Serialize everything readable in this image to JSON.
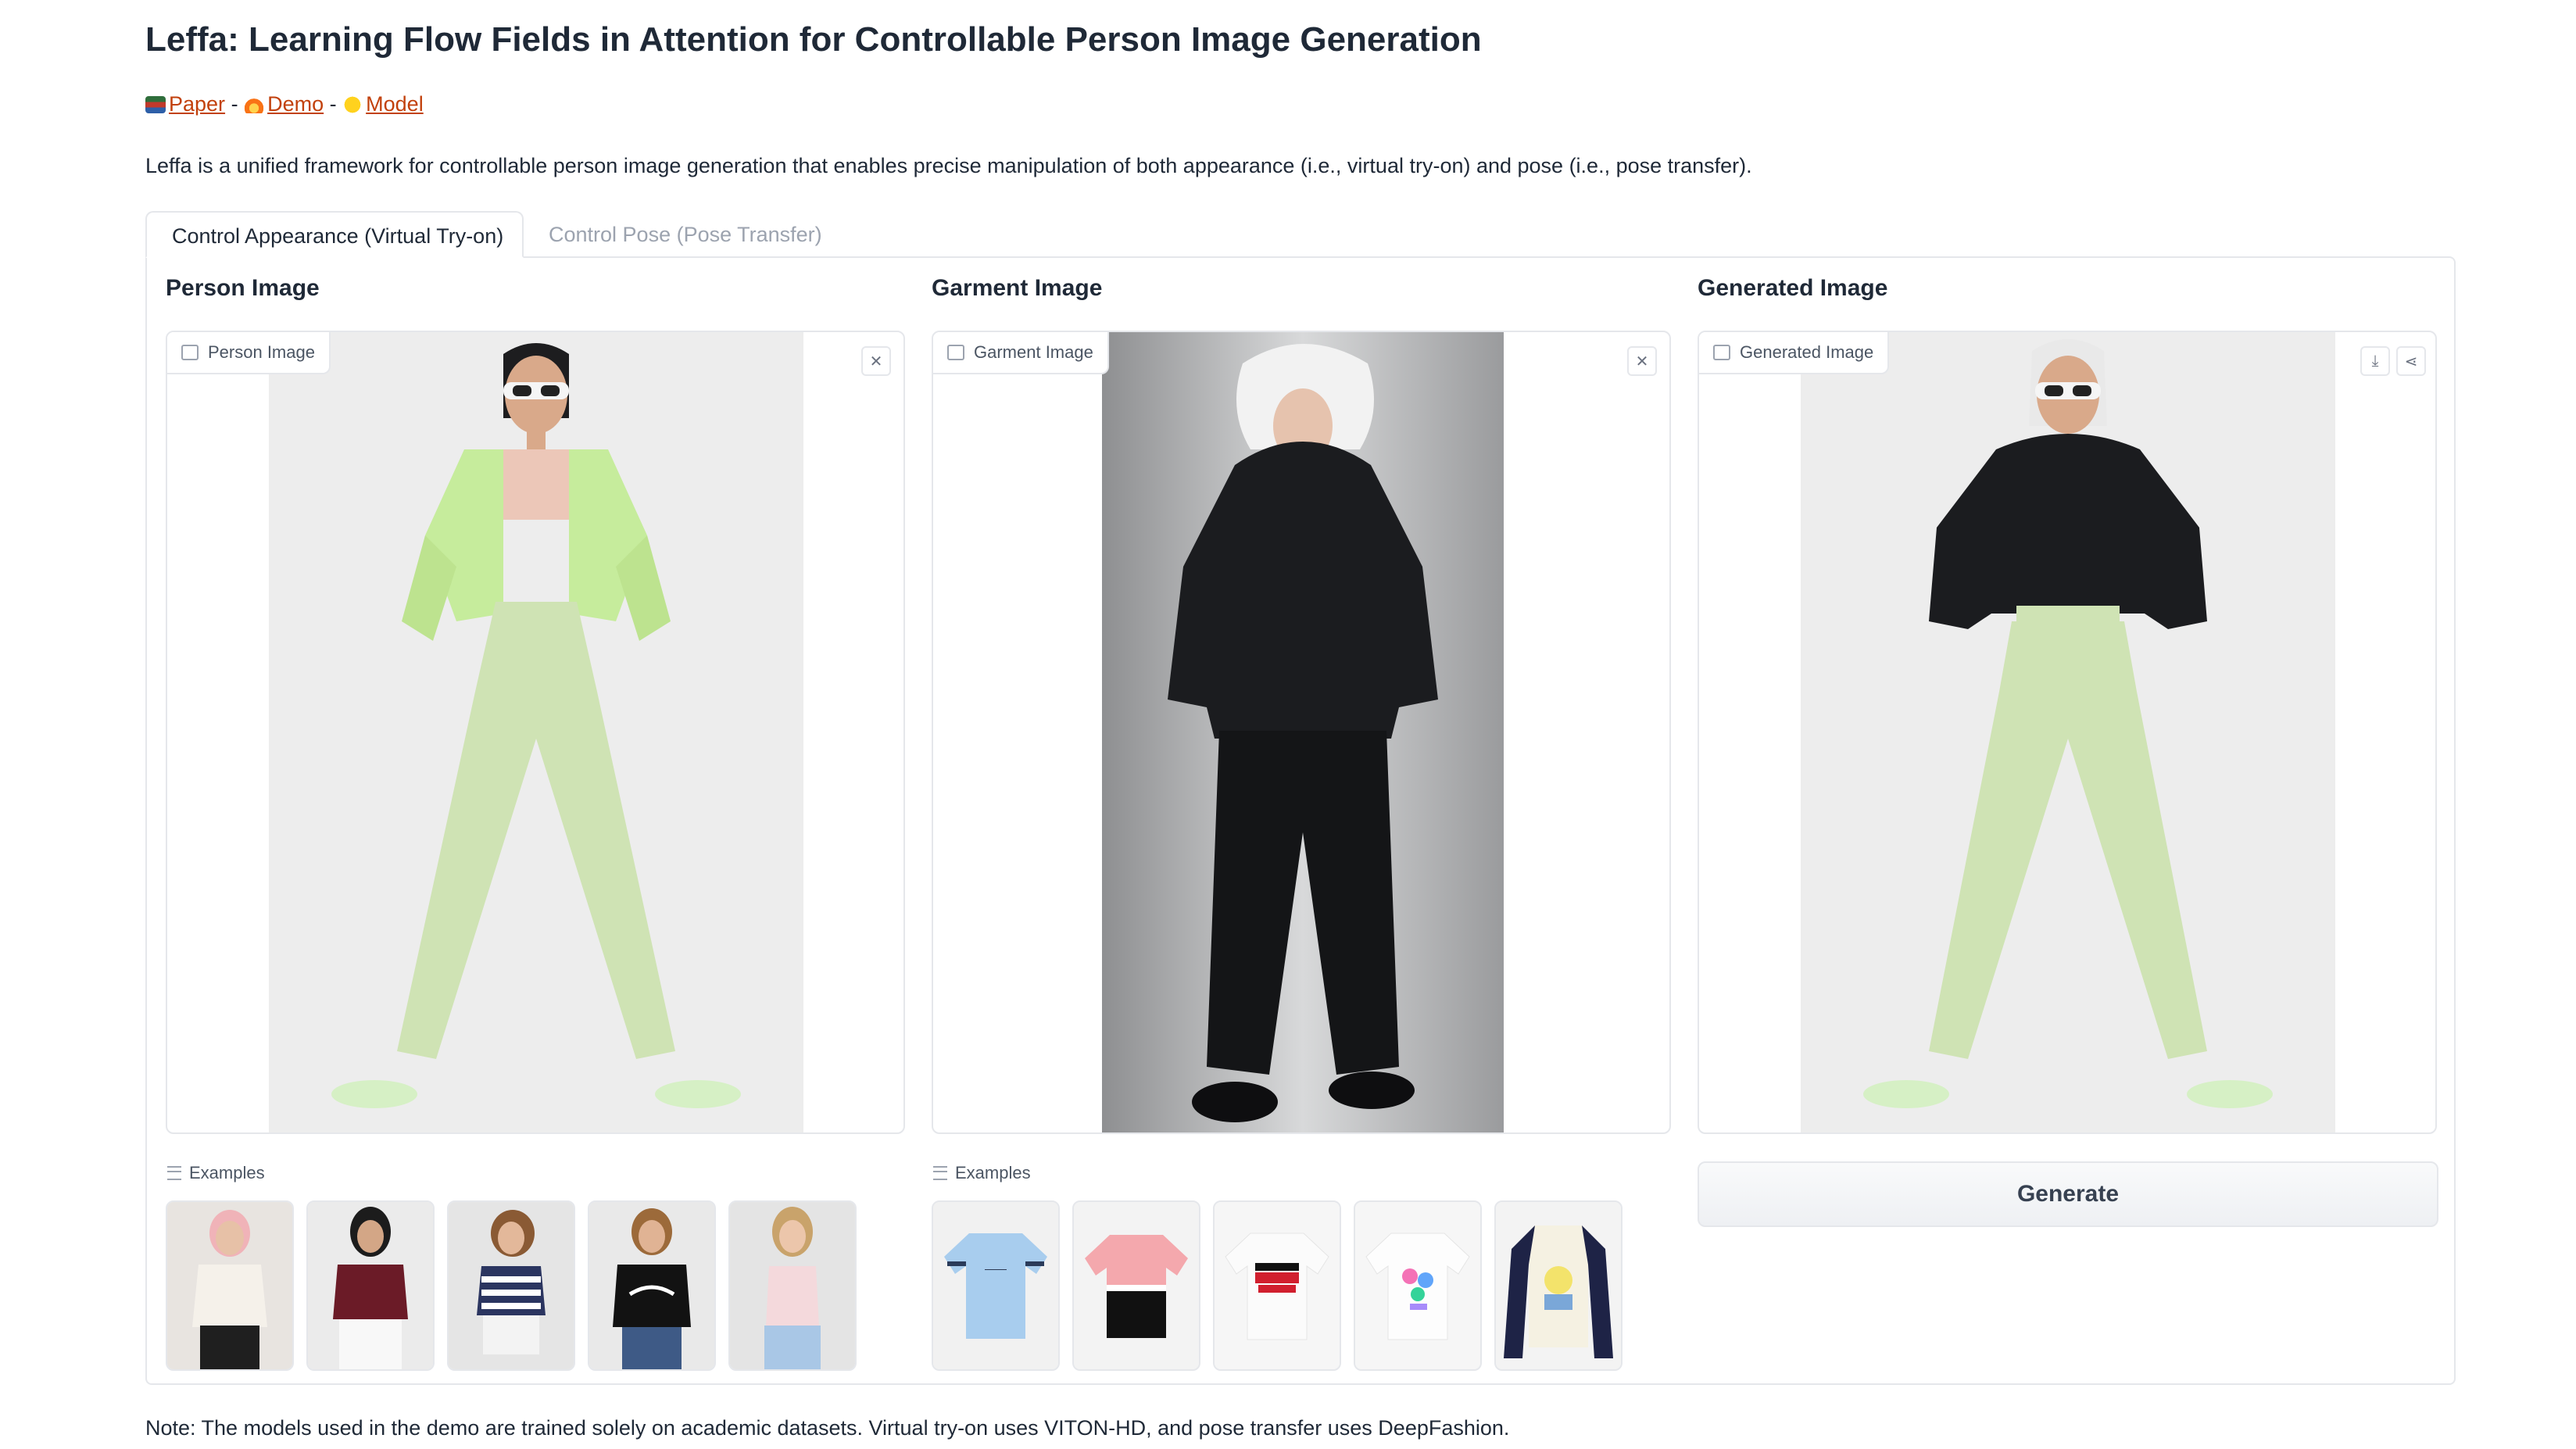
{
  "page": {
    "title": "Leffa: Learning Flow Fields in Attention for Controllable Person Image Generation",
    "links": [
      {
        "icon": "books-emoji",
        "label": "Paper"
      },
      {
        "icon": "fire-emoji",
        "label": "Demo"
      },
      {
        "icon": "hugging-face-emoji",
        "label": "Model"
      }
    ],
    "link_separator": "-",
    "description": "Leffa is a unified framework for controllable person image generation that enables precise manipulation of both appearance (i.e., virtual try-on) and pose (i.e., pose transfer).",
    "note": "Note: The models used in the demo are trained solely on academic datasets. Virtual try-on uses VITON-HD, and pose transfer uses DeepFashion."
  },
  "tabs": [
    {
      "label": "Control Appearance (Virtual Try-on)",
      "active": true
    },
    {
      "label": "Control Pose (Pose Transfer)",
      "active": false
    }
  ],
  "person": {
    "heading": "Person Image",
    "chip": "Person Image",
    "examples_label": "Examples",
    "examples_count": 5
  },
  "garment": {
    "heading": "Garment Image",
    "chip": "Garment Image",
    "examples_label": "Examples",
    "examples_count": 5
  },
  "generated": {
    "heading": "Generated Image",
    "chip": "Generated Image",
    "button": "Generate"
  },
  "colors": {
    "link": "#c2410c",
    "border": "#e5e7eb",
    "jacket_green": "#c6ec9c",
    "pants_green": "#cfe3b4",
    "hoodie_black": "#1b1c1f"
  },
  "icons": [
    "image-icon",
    "close-icon",
    "download-icon",
    "share-icon",
    "list-icon"
  ]
}
